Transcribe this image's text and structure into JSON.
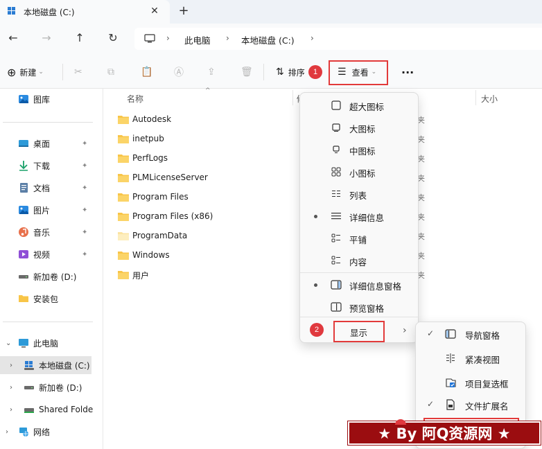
{
  "tab": {
    "title": "本地磁盘 (C:)",
    "close": "✕",
    "new": "+"
  },
  "nav": {
    "back": "←",
    "forward": "→",
    "up": "↑",
    "refresh": "↻"
  },
  "address": {
    "crumbs": [
      "此电脑",
      "本地磁盘 (C:)"
    ],
    "sep": "›"
  },
  "toolbar": {
    "new_label": "新建",
    "sort_label": "排序",
    "view_label": "查看",
    "more": "···",
    "badge1": "1",
    "caret": "⌄"
  },
  "sidebar": {
    "items": [
      {
        "label": "图库",
        "icon": "gallery-icon"
      },
      {
        "label": "桌面",
        "icon": "desktop-icon",
        "pin": "📌"
      },
      {
        "label": "下载",
        "icon": "download-icon",
        "pin": "📌"
      },
      {
        "label": "文档",
        "icon": "document-icon",
        "pin": "📌"
      },
      {
        "label": "图片",
        "icon": "picture-icon",
        "pin": "📌"
      },
      {
        "label": "音乐",
        "icon": "music-icon",
        "pin": "📌"
      },
      {
        "label": "视频",
        "icon": "video-icon",
        "pin": "📌"
      },
      {
        "label": "新加卷 (D:)",
        "icon": "drive-icon"
      },
      {
        "label": "安装包",
        "icon": "folder-icon"
      }
    ],
    "tree": [
      {
        "label": "此电脑",
        "icon": "pc-icon",
        "chevron": "⌄"
      },
      {
        "label": "本地磁盘 (C:)",
        "icon": "windows-drive-icon",
        "chevron": "›"
      },
      {
        "label": "新加卷 (D:)",
        "icon": "drive-icon",
        "chevron": "›"
      },
      {
        "label": "Shared Folde",
        "icon": "shared-drive-icon",
        "chevron": "›"
      },
      {
        "label": "网络",
        "icon": "network-icon",
        "chevron": "›"
      }
    ]
  },
  "files": {
    "col_name": "名称",
    "col_size": "大小",
    "col_modified_fragment": "修",
    "type_fragment": "夹",
    "rows": [
      "Autodesk",
      "inetpub",
      "PerfLogs",
      "PLMLicenseServer",
      "Program Files",
      "Program Files (x86)",
      "ProgramData",
      "Windows",
      "用户"
    ]
  },
  "view_menu": {
    "items": [
      {
        "label": "超大图标",
        "icon": "extra-large-icons-icon"
      },
      {
        "label": "大图标",
        "icon": "large-icons-icon"
      },
      {
        "label": "中图标",
        "icon": "medium-icons-icon"
      },
      {
        "label": "小图标",
        "icon": "small-icons-icon"
      },
      {
        "label": "列表",
        "icon": "list-icon"
      },
      {
        "label": "详细信息",
        "icon": "details-icon",
        "selected": true
      },
      {
        "label": "平铺",
        "icon": "tiles-icon"
      },
      {
        "label": "内容",
        "icon": "content-icon"
      },
      {
        "label": "详细信息窗格",
        "icon": "details-pane-icon",
        "selected": true
      },
      {
        "label": "预览窗格",
        "icon": "preview-pane-icon"
      },
      {
        "label": "显示",
        "icon": "",
        "submenu": true
      }
    ],
    "badge2": "2",
    "arrow": "›"
  },
  "show_menu": {
    "items": [
      {
        "label": "导航窗格",
        "checked": true,
        "icon": "navigation-pane-icon"
      },
      {
        "label": "紧凑视图",
        "checked": false,
        "icon": "compact-view-icon"
      },
      {
        "label": "项目复选框",
        "checked": false,
        "icon": "item-checkbox-icon"
      },
      {
        "label": "文件扩展名",
        "checked": true,
        "icon": "file-extension-icon"
      }
    ],
    "check": "✓"
  },
  "watermark": "★ By 阿Q资源网 ★",
  "colors": {
    "accent": "#e23a3a",
    "folder": "#f8c548",
    "watermark_bg": "#9b0d10"
  }
}
